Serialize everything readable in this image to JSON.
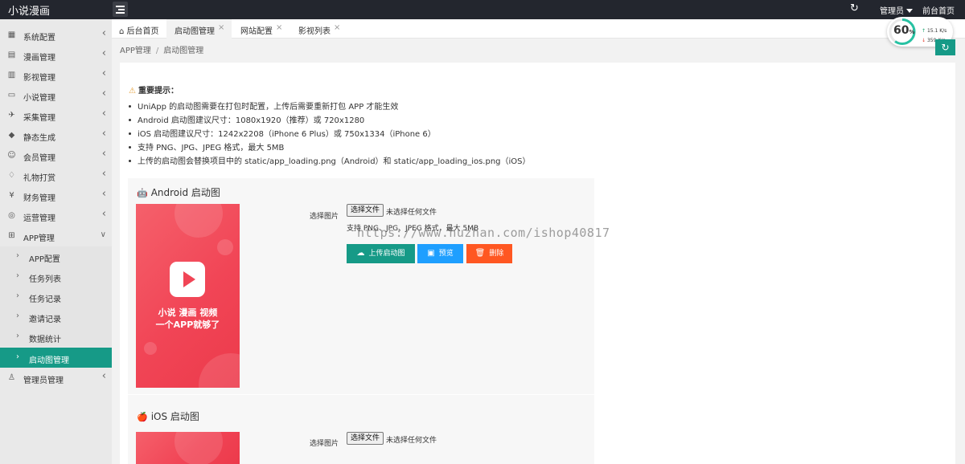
{
  "app": {
    "title": "小说漫画"
  },
  "topbar": {
    "admin_label": "管理员",
    "front_label": "前台首页",
    "refresh_icon": "refresh-icon",
    "menu_icon": "menu-toggle-icon"
  },
  "sidebar": {
    "items": [
      {
        "label": "系统配置",
        "icon": "settings-icon"
      },
      {
        "label": "漫画管理",
        "icon": "comic-icon"
      },
      {
        "label": "影视管理",
        "icon": "film-icon"
      },
      {
        "label": "小说管理",
        "icon": "book-icon"
      },
      {
        "label": "采集管理",
        "icon": "collect-icon"
      },
      {
        "label": "静态生成",
        "icon": "static-icon"
      },
      {
        "label": "会员管理",
        "icon": "member-icon"
      },
      {
        "label": "礼物打赏",
        "icon": "gift-icon"
      },
      {
        "label": "财务管理",
        "icon": "finance-icon"
      },
      {
        "label": "运营管理",
        "icon": "globe-icon"
      },
      {
        "label": "APP管理",
        "icon": "windows-icon"
      }
    ],
    "app_sub": [
      {
        "label": "APP配置"
      },
      {
        "label": "任务列表"
      },
      {
        "label": "任务记录"
      },
      {
        "label": "邀请记录"
      },
      {
        "label": "数据统计"
      },
      {
        "label": "启动图管理"
      }
    ],
    "admin_item": {
      "label": "管理员管理",
      "icon": "user-icon"
    }
  },
  "tabs": [
    {
      "label": "后台首页",
      "icon": "home-icon"
    },
    {
      "label": "启动图管理"
    },
    {
      "label": "网站配置"
    },
    {
      "label": "影视列表"
    }
  ],
  "breadcrumb": {
    "parent": "APP管理",
    "current": "启动图管理"
  },
  "speed": {
    "percent": 60,
    "percent_unit": "%",
    "up": "15.1 K/s",
    "down": "359 K/s"
  },
  "tips": {
    "title": "重要提示：",
    "lines": [
      "UniApp 的启动图需要在打包时配置，上传后需要重新打包 APP 才能生效",
      "Android 启动图建议尺寸：1080x1920（推荐）或 720x1280",
      "iOS 启动图建议尺寸：1242x2208（iPhone 6 Plus）或 750x1334（iPhone 6）",
      "支持 PNG、JPG、JPEG 格式，最大 5MB",
      "上传的启动图会替换项目中的 static/app_loading.png（Android）和 static/app_loading_ios.png（iOS）"
    ]
  },
  "android": {
    "title": "Android 启动图",
    "select_label": "选择图片",
    "file_button": "选择文件",
    "file_none": "未选择任何文件",
    "format_hint": "支持 PNG、JPG、JPEG 格式，最大 5MB",
    "upload_label": "上传启动图",
    "preview_label": "预览",
    "delete_label": "删除",
    "splash_line1": "小说 漫画 视频",
    "splash_line2": "一个APP就够了"
  },
  "ios": {
    "title": "iOS 启动图",
    "select_label": "选择图片",
    "file_button": "选择文件",
    "file_none": "未选择任何文件"
  },
  "watermark": "https://www.huzhan.com/ishop40817",
  "colors": {
    "accent": "#169a87",
    "preview": "#1e9fff",
    "delete": "#ff5722",
    "topbar": "#23262e"
  }
}
